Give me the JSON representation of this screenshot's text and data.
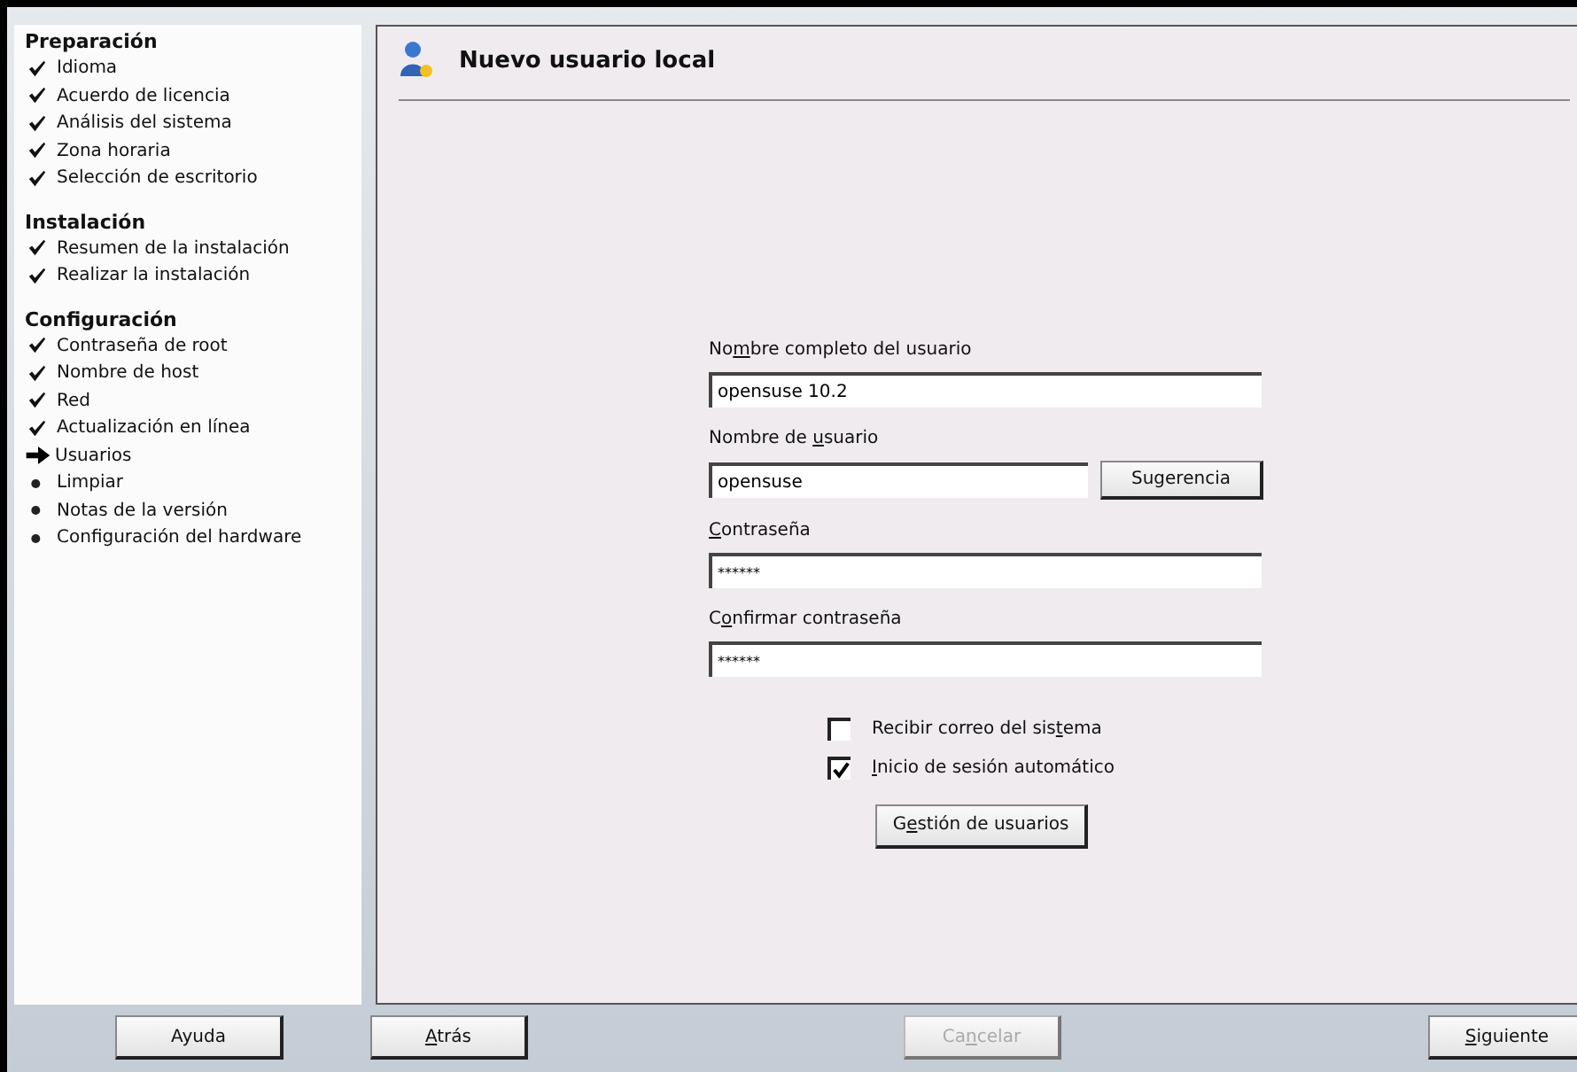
{
  "sidebar": {
    "sections": [
      {
        "title": "Preparación",
        "items": [
          {
            "label": "Idioma",
            "kind": "done"
          },
          {
            "label": "Acuerdo de licencia",
            "kind": "done"
          },
          {
            "label": "Análisis del sistema",
            "kind": "done"
          },
          {
            "label": "Zona horaria",
            "kind": "done"
          },
          {
            "label": "Selección de escritorio",
            "kind": "done"
          }
        ]
      },
      {
        "title": "Instalación",
        "items": [
          {
            "label": "Resumen de la instalación",
            "kind": "done"
          },
          {
            "label": "Realizar la instalación",
            "kind": "done"
          }
        ]
      },
      {
        "title": "Configuración",
        "items": [
          {
            "label": "Contraseña de root",
            "kind": "done"
          },
          {
            "label": "Nombre de host",
            "kind": "done"
          },
          {
            "label": "Red",
            "kind": "done"
          },
          {
            "label": "Actualización en línea",
            "kind": "done"
          },
          {
            "label": "Usuarios",
            "kind": "current"
          },
          {
            "label": "Limpiar",
            "kind": "pending"
          },
          {
            "label": "Notas de la versión",
            "kind": "pending"
          },
          {
            "label": "Configuración del hardware",
            "kind": "pending"
          }
        ]
      }
    ]
  },
  "panel": {
    "title": "Nuevo usuario local",
    "fields": [
      {
        "label": {
          "before": "No",
          "key": "m",
          "after": "bre completo del usuario"
        },
        "value": "opensuse 10.2",
        "kind": "text"
      },
      {
        "label": {
          "before": "Nombre de ",
          "key": "u",
          "after": "suario"
        },
        "value": "opensuse",
        "kind": "text_with_button",
        "button": "Sugerencia"
      },
      {
        "label": {
          "key": "C",
          "after": "ontraseña"
        },
        "value": "******",
        "kind": "password"
      },
      {
        "label": {
          "before": "C",
          "key": "o",
          "after": "nfirmar contraseña"
        },
        "value": "******",
        "kind": "password"
      }
    ],
    "checkboxes": [
      {
        "label": {
          "before": "Recibir correo del sis",
          "key": "t",
          "after": "ema"
        },
        "checked": false
      },
      {
        "label": {
          "key": "I",
          "after": "nicio de sesión automático"
        },
        "checked": true
      }
    ],
    "button": {
      "before": "G",
      "key": "e",
      "after": "stión de usuarios"
    }
  },
  "buttons": [
    {
      "label": {
        "before": "Ayuda"
      },
      "disabled": false
    },
    {
      "label": {
        "key": "A",
        "after": "trás"
      },
      "disabled": false
    },
    {
      "label": {
        "before": "Ca",
        "key": "n",
        "after": "celar"
      },
      "disabled": true
    },
    {
      "label": {
        "key": "S",
        "after": "iguiente"
      },
      "disabled": false
    }
  ]
}
